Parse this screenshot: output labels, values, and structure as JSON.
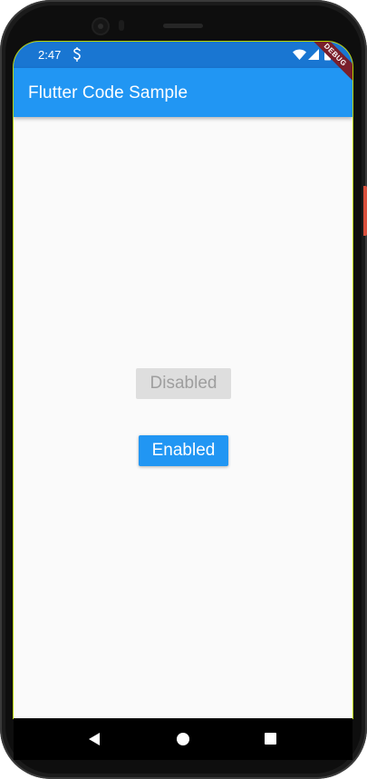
{
  "status_bar": {
    "time": "2:47",
    "icons": [
      "s-sync-icon",
      "wifi-icon",
      "cellular-icon",
      "battery-icon"
    ],
    "color": "#1976d2"
  },
  "app_bar": {
    "title": "Flutter Code Sample",
    "color": "#2196f3"
  },
  "debug_banner": {
    "label": "DEBUG"
  },
  "buttons": {
    "disabled_label": "Disabled",
    "enabled_label": "Enabled"
  },
  "nav_bar": {
    "icons": [
      "back-icon",
      "home-icon",
      "recents-icon"
    ]
  }
}
